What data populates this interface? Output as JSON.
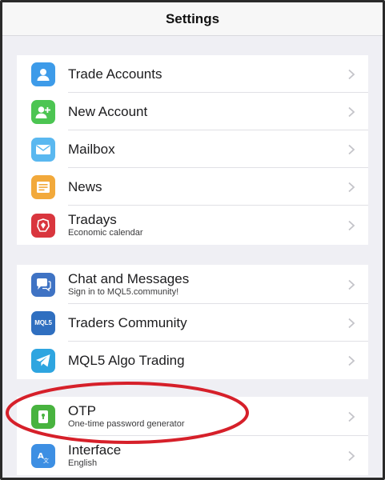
{
  "header": {
    "title": "Settings"
  },
  "groups": [
    {
      "items": [
        {
          "label": "Trade Accounts",
          "icon": "person-icon",
          "color": "#3d9be9"
        },
        {
          "label": "New Account",
          "icon": "add-person-icon",
          "color": "#4cc552"
        },
        {
          "label": "Mailbox",
          "icon": "mail-icon",
          "color": "#5ab8f0"
        },
        {
          "label": "News",
          "icon": "news-icon",
          "color": "#f2a93b"
        },
        {
          "label": "Tradays",
          "sub": "Economic calendar",
          "icon": "calendar-icon",
          "color": "#d9363e"
        }
      ]
    },
    {
      "items": [
        {
          "label": "Chat and Messages",
          "sub": "Sign in to MQL5.community!",
          "icon": "chat-icon",
          "color": "#3f73c4"
        },
        {
          "label": "Traders Community",
          "icon": "mql5-community-icon",
          "color": "#2f6fc0",
          "icon_text": "MQL5"
        },
        {
          "label": "MQL5 Algo Trading",
          "icon": "telegram-icon",
          "color": "#2ea5e0"
        }
      ]
    },
    {
      "items": [
        {
          "label": "OTP",
          "sub": "One-time password generator",
          "icon": "lock-icon",
          "color": "#48b33f"
        },
        {
          "label": "Interface",
          "sub": "English",
          "icon": "language-icon",
          "color": "#3d8fe3"
        }
      ]
    }
  ],
  "annotation": {
    "color": "#d6202a"
  }
}
